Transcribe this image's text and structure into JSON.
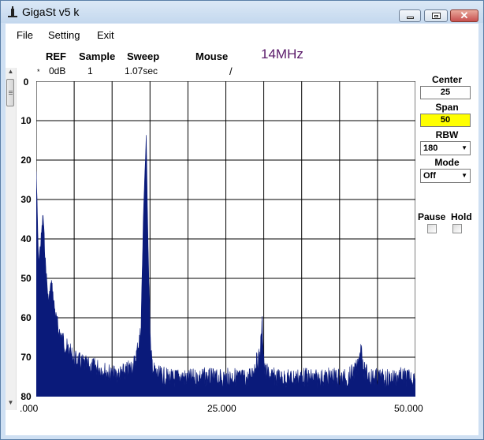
{
  "window": {
    "title": "GigaSt v5 k"
  },
  "menu": [
    "File",
    "Setting",
    "Exit"
  ],
  "header": {
    "ref_label": "REF",
    "sample_label": "Sample",
    "sweep_label": "Sweep",
    "mouse_label": "Mouse",
    "frequency": "14MHz",
    "marker": "*",
    "ref_value": "0dB",
    "sample_value": "1",
    "sweep_value": "1.07sec",
    "mouse_value": "/"
  },
  "controls": {
    "center_label": "Center",
    "center_value": "25",
    "span_label": "Span",
    "span_value": "50",
    "rbw_label": "RBW",
    "rbw_value": "180",
    "mode_label": "Mode",
    "mode_value": "Off",
    "pause_label": "Pause",
    "hold_label": "Hold"
  },
  "colors": {
    "trace": "#0a1a7a",
    "span_highlight": "#ffff00",
    "title_freq": "#5a1a6a"
  },
  "chart_data": {
    "type": "area",
    "ylabels": [
      "0",
      "10",
      "20",
      "30",
      "40",
      "50",
      "60",
      "70",
      "80"
    ],
    "xlabels": [
      ".000",
      "25.000",
      "50.000"
    ],
    "xlim": [
      0,
      50
    ],
    "ylim": [
      0,
      80
    ],
    "y_inverted": true,
    "grid": true,
    "series": [
      {
        "x": [
          0,
          0.3,
          0.6,
          0.9,
          1.2,
          1.6,
          2,
          2.5,
          3,
          3.5,
          4,
          5,
          6,
          7,
          8,
          9,
          10,
          11,
          12,
          13,
          13.8,
          14.2,
          14.5,
          14.8,
          15.1,
          15.5,
          16,
          17,
          18,
          19,
          20,
          22,
          24,
          26,
          28,
          29.5,
          29.8,
          30.1,
          31,
          33,
          35,
          37,
          39,
          41,
          42.5,
          42.8,
          43.2,
          44,
          46,
          48,
          50
        ],
        "y": [
          22,
          45,
          40,
          33,
          45,
          55,
          50,
          58,
          62,
          64,
          66,
          69,
          70,
          71,
          71,
          72,
          73,
          73,
          72,
          70,
          62,
          28,
          14,
          45,
          68,
          72,
          73,
          73.5,
          74,
          73.5,
          74,
          73.5,
          74,
          73.5,
          74,
          68,
          60,
          72,
          73.5,
          74,
          73.5,
          74,
          73.5,
          74,
          71,
          65,
          72,
          73.5,
          74,
          73.5,
          74
        ]
      }
    ]
  }
}
